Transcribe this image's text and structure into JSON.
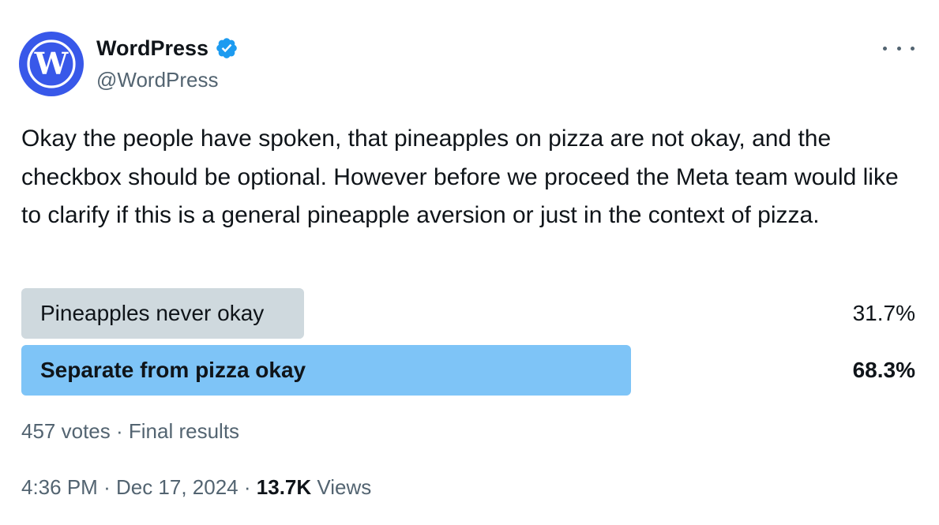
{
  "author": {
    "display_name": "WordPress",
    "handle": "@WordPress",
    "avatar_icon": "wordpress-logo-icon",
    "verified_icon": "verified-badge-icon",
    "avatar_color": "#3858e9",
    "verified_color": "#1d9bf0"
  },
  "more_icon": "more-options-icon",
  "body": "Okay the people have spoken, that pineapples on pizza are not okay, and the checkbox should be optional. However before we proceed the Meta team would like to clarify if this is a general pineapple aversion or just in the context of pizza.",
  "poll": {
    "options": [
      {
        "label": "Pineapples never okay",
        "percent": 31.7,
        "percent_text": "31.7%",
        "winner": false,
        "color": "#cfd9de"
      },
      {
        "label": "Separate from pizza okay",
        "percent": 68.3,
        "percent_text": "68.3%",
        "winner": true,
        "color": "#7ec4f7"
      }
    ],
    "votes": "457 votes",
    "separator": "·",
    "status": "Final results"
  },
  "meta": {
    "time": "4:36 PM",
    "separator": "·",
    "date": "Dec 17, 2024",
    "views_count": "13.7K",
    "views_label": "Views"
  }
}
